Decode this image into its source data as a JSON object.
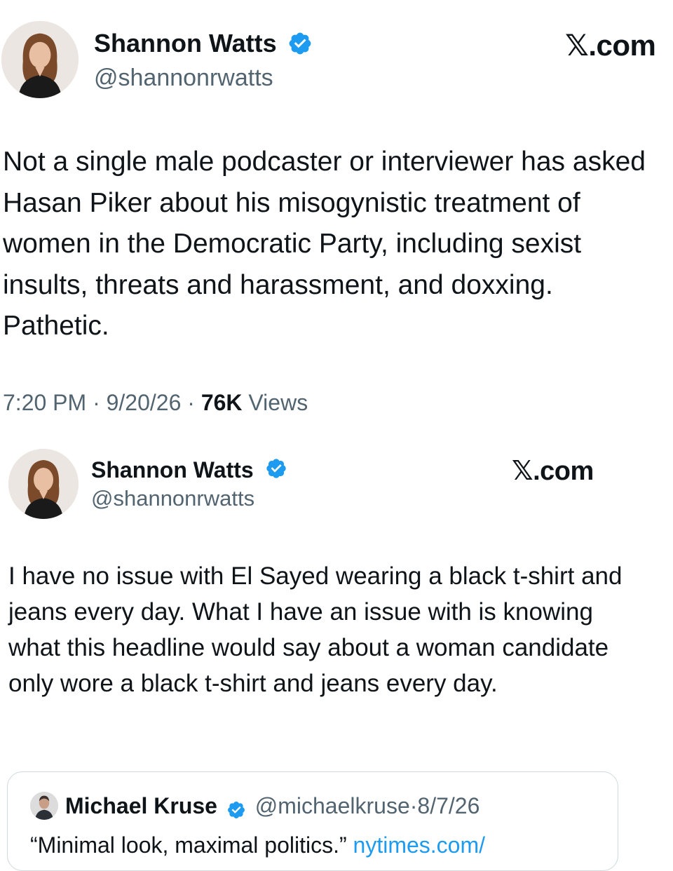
{
  "post1": {
    "author_name": "Shannon Watts",
    "author_handle": "@shannonrwatts",
    "source": "𝕏.com",
    "text": "Not a single male podcaster or interviewer has asked Hasan Piker about his misogynistic treatment of women in the Democratic Party, including sexist insults, threats and harassment, and doxxing. Pathetic.",
    "time": "7:20 PM",
    "date": "9/20/26",
    "views_count": "76K",
    "views_label": "Views",
    "separator": "·"
  },
  "post2": {
    "author_name": "Shannon Watts",
    "author_handle": "@shannonrwatts",
    "source": "𝕏.com",
    "text": "I have no issue with El Sayed wearing a black t-shirt and jeans every day. What I have an issue with is knowing what this headline would say about a woman candidate only wore a black t-shirt and jeans every day."
  },
  "quote": {
    "author_name": "Michael Kruse",
    "author_handle": "@michaelkruse",
    "separator": "·",
    "date": "8/7/26",
    "text_visible": "“Minimal look, maximal politics.”",
    "link_visible": "nytimes.com/"
  },
  "colors": {
    "verified_blue": "#1d9bf0",
    "text_primary": "#0f1419",
    "text_secondary": "#536471",
    "link": "#1d9bf0"
  },
  "icons": {
    "verified": "verified-badge-icon",
    "avatar": "profile-photo"
  }
}
